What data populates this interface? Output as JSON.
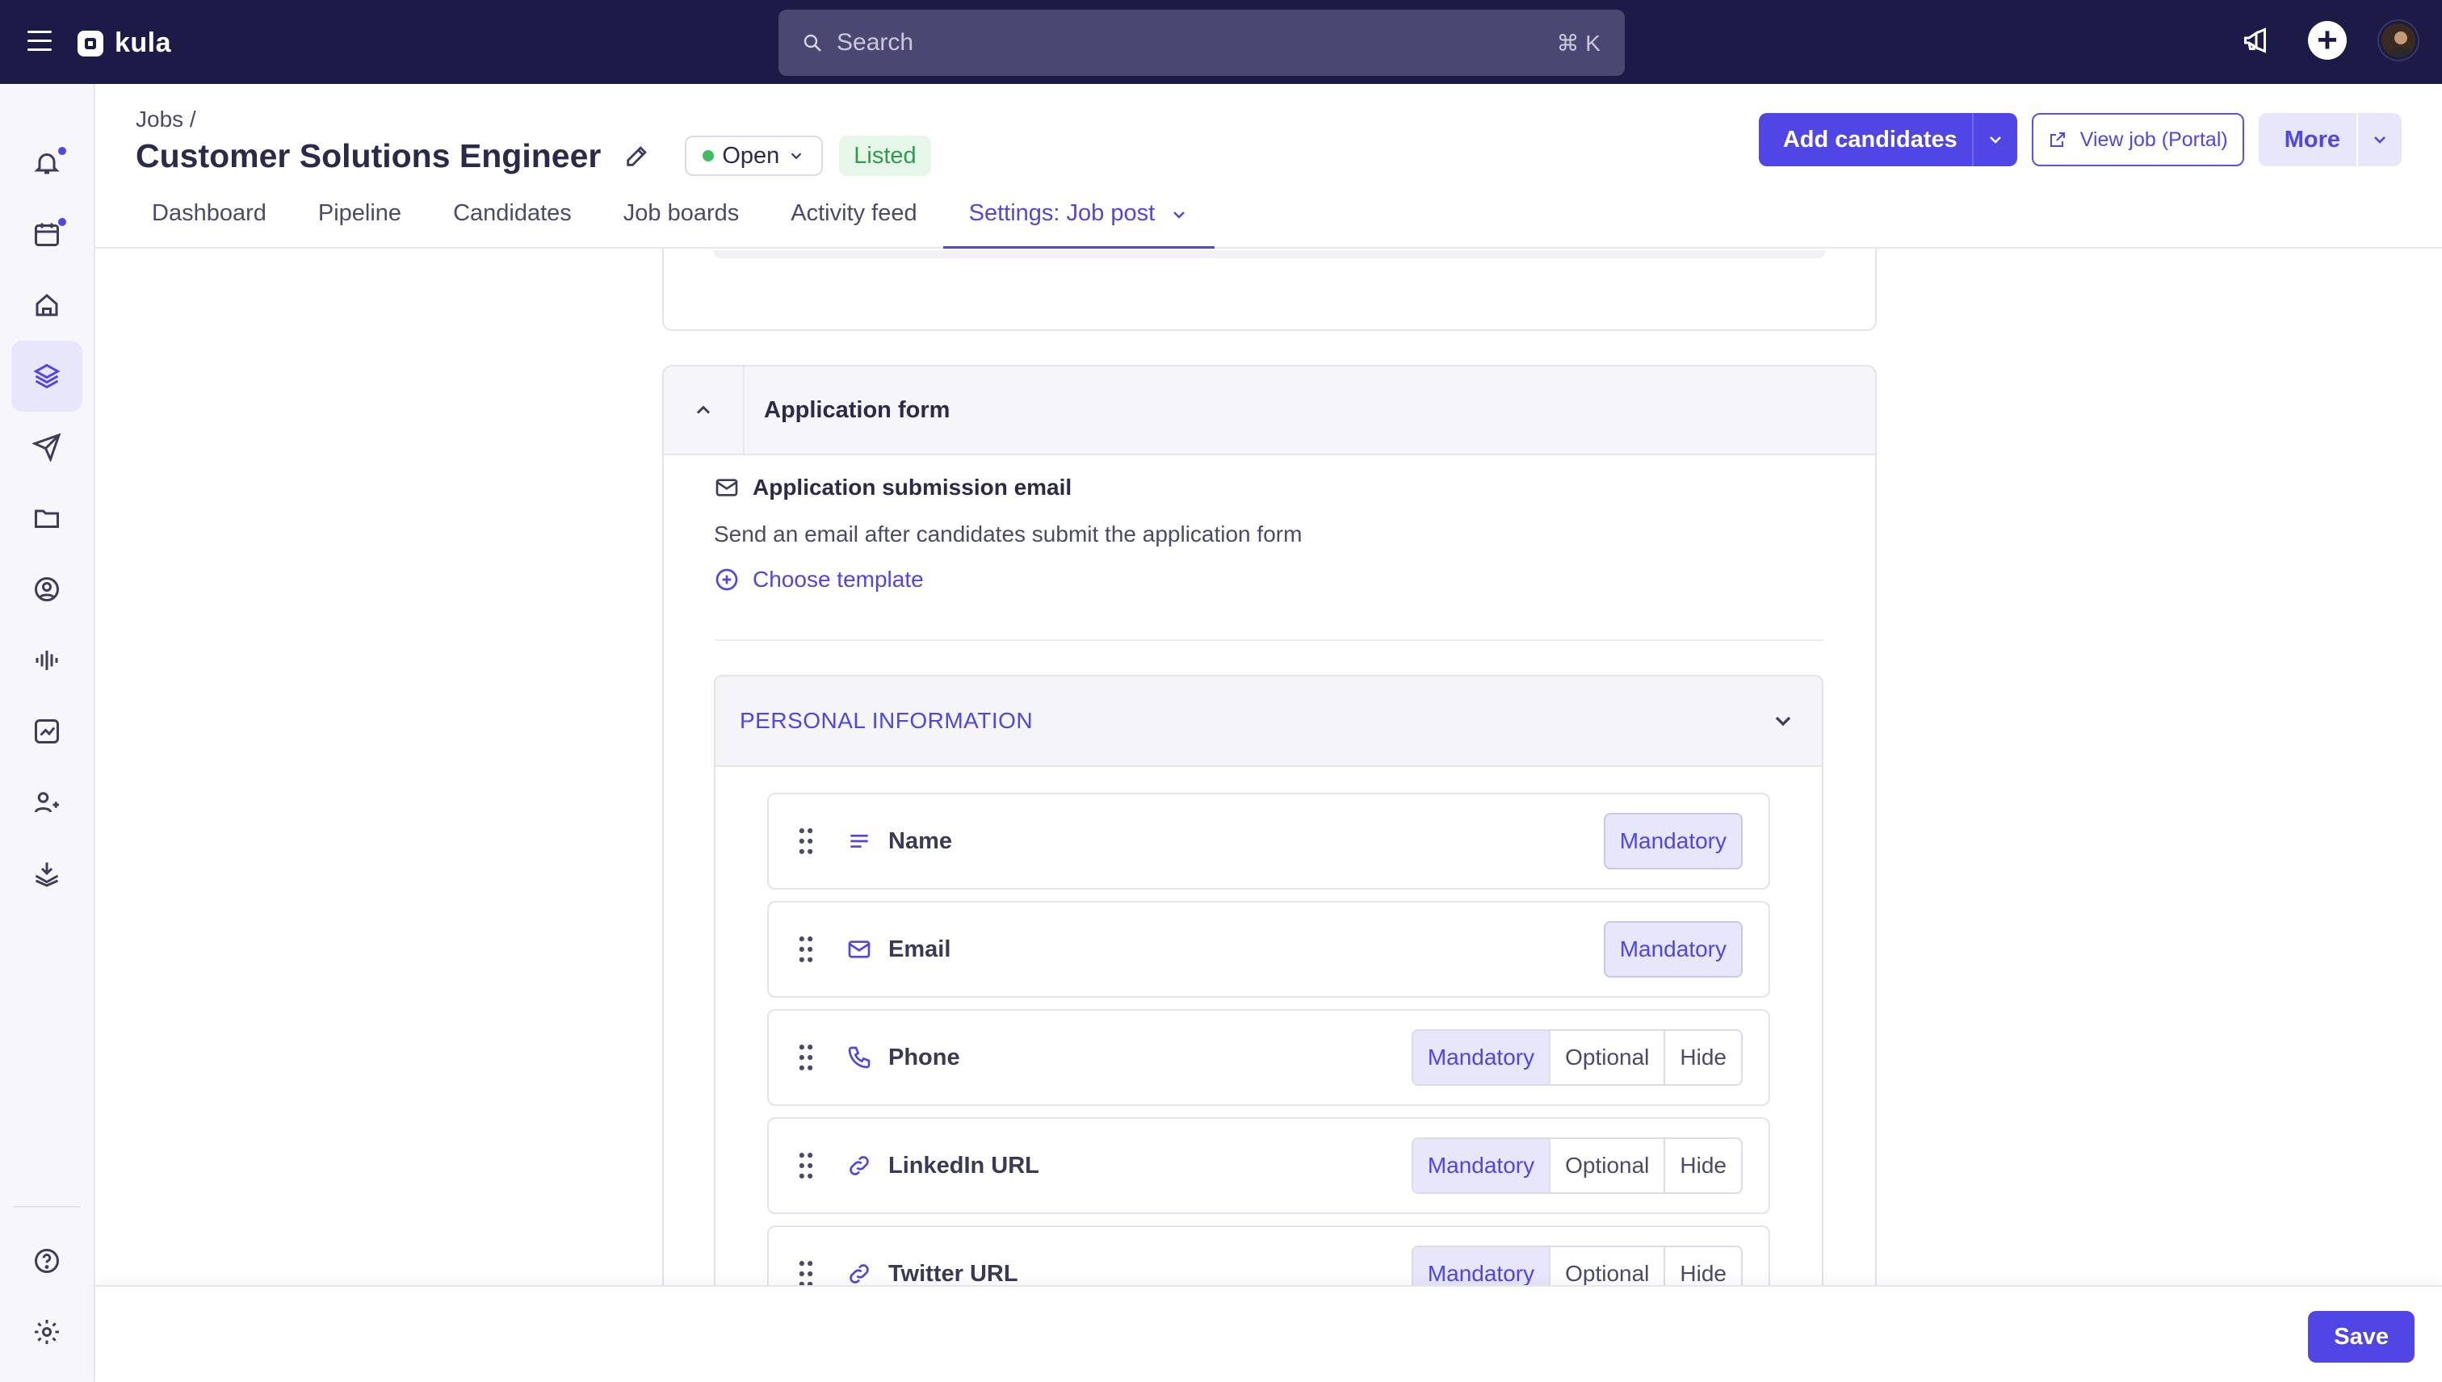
{
  "app": {
    "name": "kula"
  },
  "search": {
    "placeholder": "Search",
    "shortcut": "⌘ K"
  },
  "breadcrumb": "Jobs /",
  "job": {
    "title": "Customer Solutions Engineer",
    "status": "Open",
    "visibility": "Listed"
  },
  "actions": {
    "add_candidates": "Add candidates",
    "view_job": "View job (Portal)",
    "more": "More"
  },
  "tabs": [
    {
      "label": "Dashboard"
    },
    {
      "label": "Pipeline"
    },
    {
      "label": "Candidates"
    },
    {
      "label": "Job boards"
    },
    {
      "label": "Activity feed"
    },
    {
      "label": "Settings: Job post",
      "active": true
    }
  ],
  "application_form": {
    "title": "Application form",
    "email": {
      "title": "Application submission email",
      "description": "Send an email after candidates submit the application form",
      "choose_template": "Choose template"
    },
    "personal_information": {
      "title": "PERSONAL INFORMATION",
      "fields": [
        {
          "label": "Name",
          "icon": "text-lines-icon",
          "options": [
            "Mandatory"
          ],
          "selected": "Mandatory"
        },
        {
          "label": "Email",
          "icon": "mail-icon",
          "options": [
            "Mandatory"
          ],
          "selected": "Mandatory"
        },
        {
          "label": "Phone",
          "icon": "phone-icon",
          "options": [
            "Mandatory",
            "Optional",
            "Hide"
          ],
          "selected": "Mandatory"
        },
        {
          "label": "LinkedIn URL",
          "icon": "link-icon",
          "options": [
            "Mandatory",
            "Optional",
            "Hide"
          ],
          "selected": "Mandatory"
        },
        {
          "label": "Twitter URL",
          "icon": "link-icon",
          "options": [
            "Mandatory",
            "Optional",
            "Hide"
          ],
          "selected": "Mandatory"
        }
      ]
    }
  },
  "footer": {
    "save_label": "Save"
  },
  "colors": {
    "accent": "#4f46e5",
    "topbar": "#1c1a47",
    "open_dot": "#3fbd61",
    "listed_bg": "#e6f7ea"
  }
}
